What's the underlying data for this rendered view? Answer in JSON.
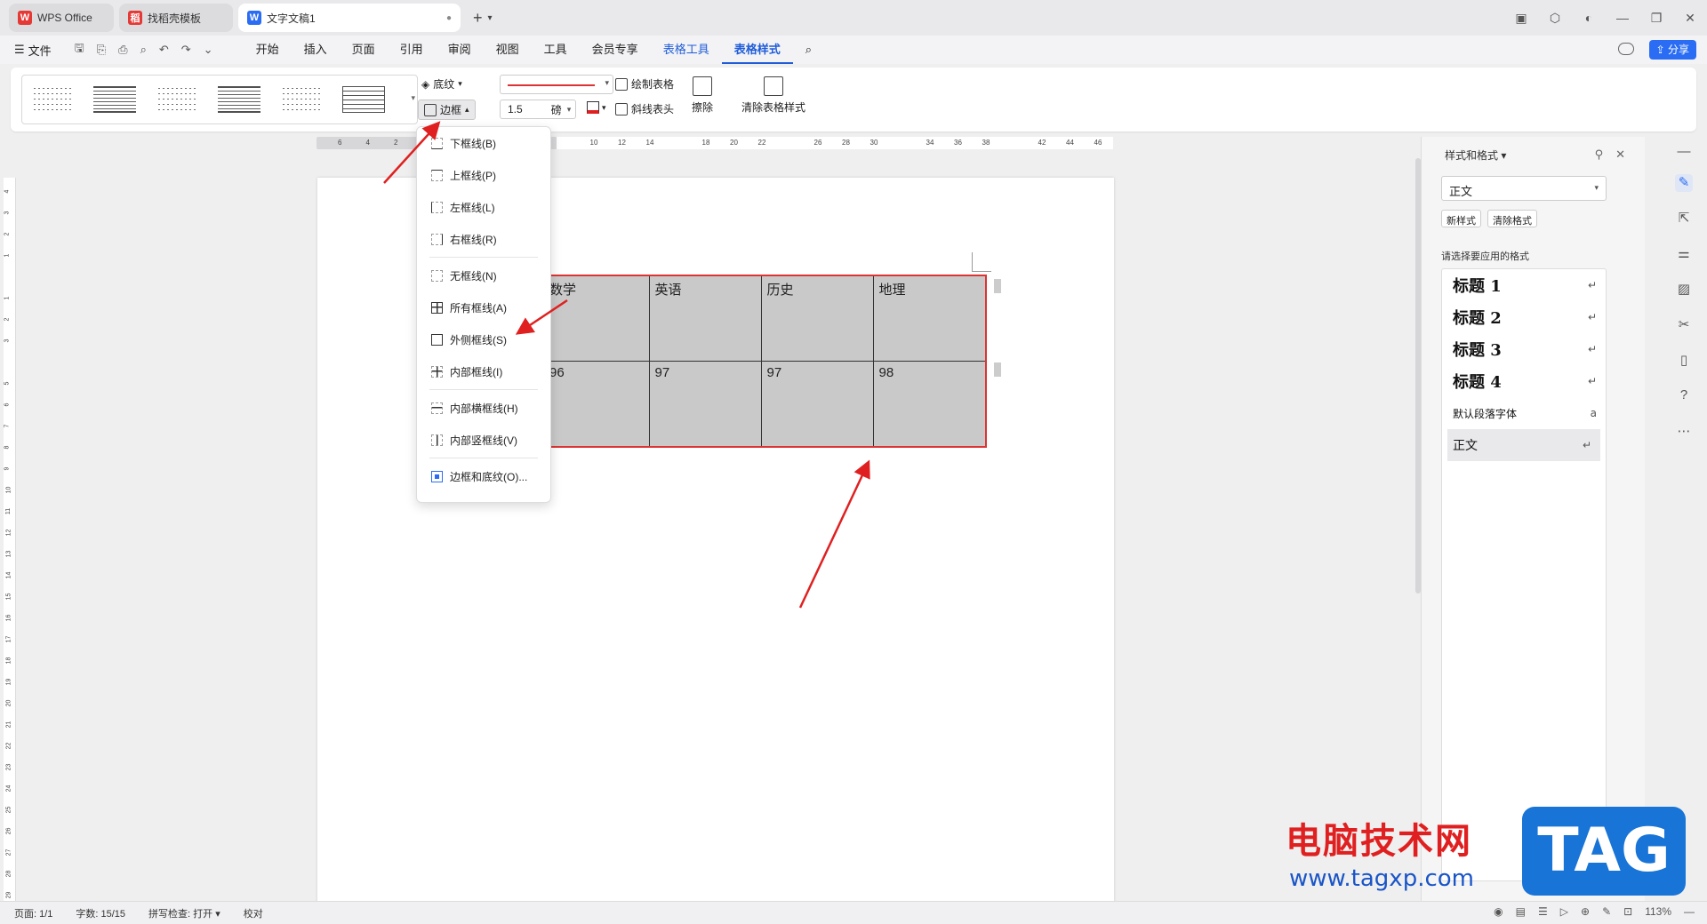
{
  "tabs": [
    {
      "label": "WPS Office",
      "color": "#e53935"
    },
    {
      "label": "找稻壳模板",
      "color": "#e53935"
    },
    {
      "label": "文字文稿1",
      "color": "#2a6df4"
    }
  ],
  "menubar": {
    "file": "文件",
    "items": [
      "开始",
      "插入",
      "页面",
      "引用",
      "审阅",
      "视图",
      "工具",
      "会员专享",
      "表格工具",
      "表格样式"
    ],
    "active": "表格样式",
    "share": "分享"
  },
  "ribbon": {
    "shading": "底纹",
    "border": "边框",
    "line_width": "1.5",
    "line_unit": "磅",
    "draw_table": "绘制表格",
    "diagonal_header": "斜线表头",
    "erase": "擦除",
    "clear_style": "清除表格样式"
  },
  "ruler_numbers": [
    "6",
    "4",
    "2",
    "",
    "",
    "",
    "",
    "",
    "",
    "10",
    "12",
    "14",
    "",
    "18",
    "20",
    "22",
    "",
    "26",
    "28",
    "30",
    "",
    "34",
    "36",
    "38",
    "",
    "42",
    "44",
    "46"
  ],
  "vruler_numbers": [
    "4",
    "3",
    "2",
    "1",
    "",
    "1",
    "2",
    "3",
    "",
    "5",
    "6",
    "7",
    "8",
    "9",
    "10",
    "11",
    "12",
    "13",
    "14",
    "15",
    "16",
    "17",
    "18",
    "19",
    "20",
    "21",
    "22",
    "23",
    "24",
    "25",
    "26",
    "27",
    "28",
    "29"
  ],
  "border_menu": {
    "items": [
      {
        "label": "下框线(B)",
        "icon": "border-bottom"
      },
      {
        "label": "上框线(P)",
        "icon": "border-top"
      },
      {
        "label": "左框线(L)",
        "icon": "border-left"
      },
      {
        "label": "右框线(R)",
        "icon": "border-right"
      },
      {
        "label": "无框线(N)",
        "icon": "border-none"
      },
      {
        "label": "所有框线(A)",
        "icon": "border-all"
      },
      {
        "label": "外侧框线(S)",
        "icon": "border-outer"
      },
      {
        "label": "内部框线(I)",
        "icon": "border-inner"
      },
      {
        "label": "内部横框线(H)",
        "icon": "border-inner-horizontal"
      },
      {
        "label": "内部竖框线(V)",
        "icon": "border-inner-vertical"
      },
      {
        "label": "边框和底纹(O)...",
        "icon": "border-dialog"
      }
    ]
  },
  "table": {
    "rows": [
      [
        "数学",
        "英语",
        "历史",
        "地理"
      ],
      [
        "96",
        "97",
        "97",
        "98"
      ]
    ],
    "cell_fill": "#c9c9c9",
    "outline_color": "#dd3333"
  },
  "styles_panel": {
    "title": "样式和格式",
    "current": "正文",
    "new_style": "新样式",
    "clear_format": "清除格式",
    "hint": "请选择要应用的格式",
    "items": [
      "标题 1",
      "标题 2",
      "标题 3",
      "标题 4",
      "默认段落字体",
      "正文"
    ]
  },
  "status": {
    "page": "页面: 1/1",
    "words": "字数: 15/15",
    "spell": "拼写检查: 打开",
    "proof": "校对",
    "zoom": "113%"
  },
  "watermark": {
    "text": "电脑技术网",
    "url": "www.tagxp.com",
    "badge": "TAG"
  }
}
